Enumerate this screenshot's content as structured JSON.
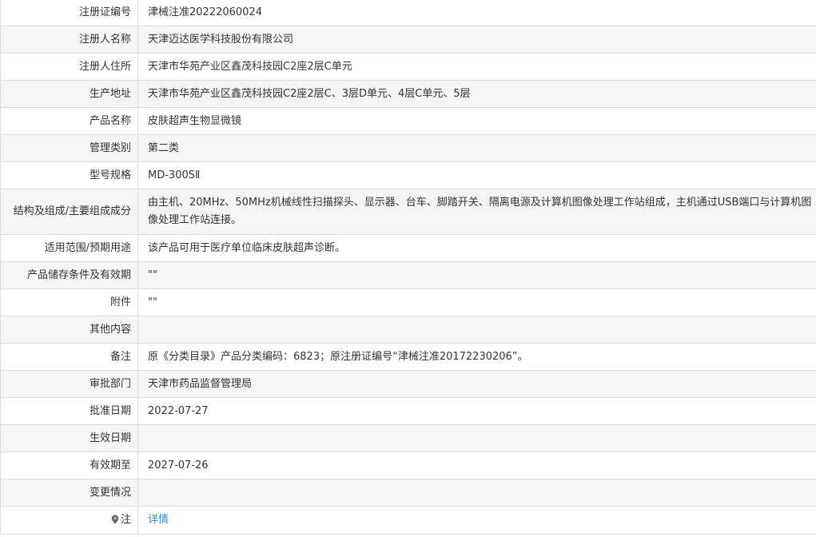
{
  "rows": [
    {
      "label": "注册证编号",
      "value": "津械注准20222060024"
    },
    {
      "label": "注册人名称",
      "value": "天津迈达医学科技股份有限公司"
    },
    {
      "label": "注册人住所",
      "value": "天津市华苑产业区鑫茂科技园C2座2层C单元"
    },
    {
      "label": "生产地址",
      "value": "天津市华苑产业区鑫茂科技园C2座2层C、3层D单元、4层C单元、5层"
    },
    {
      "label": "产品名称",
      "value": "皮肤超声生物显微镜"
    },
    {
      "label": "管理类别",
      "value": "第二类"
    },
    {
      "label": "型号规格",
      "value": "MD-300SⅡ"
    },
    {
      "label": "结构及组成/主要组成成分",
      "value": "由主机、20MHz、50MHz机械线性扫描探头、显示器、台车、脚踏开关、隔离电源及计算机图像处理工作站组成，主机通过USB端口与计算机图像处理工作站连接。"
    },
    {
      "label": "适用范围/预期用途",
      "value": "该产品可用于医疗单位临床皮肤超声诊断。"
    },
    {
      "label": "产品储存条件及有效期",
      "value": "\"\""
    },
    {
      "label": "附件",
      "value": "\"\""
    },
    {
      "label": "其他内容",
      "value": ""
    },
    {
      "label": "备注",
      "value": "原《分类目录》产品分类编码：6823；原注册证编号“津械注准20172230206”。"
    },
    {
      "label": "审批部门",
      "value": "天津市药品监督管理局"
    },
    {
      "label": "批准日期",
      "value": "2022-07-27"
    },
    {
      "label": "生效日期",
      "value": ""
    },
    {
      "label": "有效期至",
      "value": "2027-07-26"
    },
    {
      "label": "变更情况",
      "value": ""
    }
  ],
  "note": {
    "label": "注",
    "icon": "map-pin-icon",
    "link_text": "详情"
  }
}
